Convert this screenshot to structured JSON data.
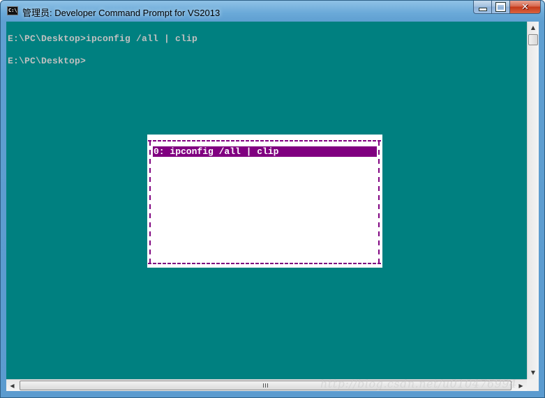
{
  "window": {
    "title": "管理员: Developer Command Prompt for VS2013",
    "icon_text": "C:\\"
  },
  "console": {
    "lines": [
      "E:\\PC\\Desktop>ipconfig /all | clip",
      "E:\\PC\\Desktop>"
    ]
  },
  "history_popup": {
    "items": [
      "0: ipconfig /all | clip"
    ]
  },
  "scrollbar": {
    "up_arrow": "▲",
    "down_arrow": "▼",
    "left_arrow": "◀",
    "right_arrow": "▶"
  },
  "watermark": "http://blog.csdn.net/u010476994",
  "colors": {
    "console_bg": "#008080",
    "console_text": "#c0c0c0",
    "popup_accent": "#800080"
  }
}
